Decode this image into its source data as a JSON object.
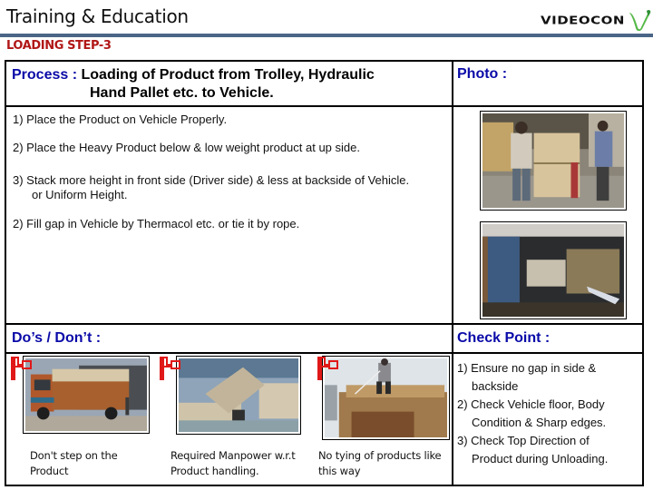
{
  "header": {
    "title": "Training & Education",
    "brand": "VIDEOCON",
    "brand_color": "#55b847",
    "rule_color": "#4a6585",
    "subtitle": "LOADING STEP-3",
    "subtitle_color": "#b11616"
  },
  "process": {
    "label": "Process :",
    "line1": "Loading of Product from Trolley,  Hydraulic",
    "line2": "Hand Pallet etc. to Vehicle."
  },
  "photo_section": {
    "label": "Photo :",
    "photos": [
      {
        "alt": "Workers moving boxed product on hydraulic hand pallet in warehouse"
      },
      {
        "alt": "Inside of container vehicle with loaded product"
      }
    ]
  },
  "steps": [
    {
      "line1": "1) Place the Product on Vehicle Properly.",
      "line2": ""
    },
    {
      "line1": "2) Place the Heavy Product below & low weight product at up side.",
      "line2": ""
    },
    {
      "line1": "3) Stack more height in front side (Driver side) & less at backside of Vehicle.",
      "line2": "or Uniform Height."
    },
    {
      "line1": "2) Fill gap in Vehicle by Thermacol etc. or tie it by rope.",
      "line2": ""
    }
  ],
  "dos_donts": {
    "label": "Do’s / Don’t :",
    "items": [
      {
        "caption1": "Don't step on the",
        "caption2": "Product",
        "alt": "Loaded truck with products"
      },
      {
        "caption1": "Required Manpower w.r.t",
        "caption2": "Product handling.",
        "alt": "Worker handling tilted product box"
      },
      {
        "caption1": "No tying of products like",
        "caption2": "this way",
        "alt": "Worker tying products with rope on top of vehicle"
      }
    ]
  },
  "check_point": {
    "label": "Check Point :",
    "items": [
      {
        "line1": "1) Ensure no gap in side &",
        "line2": "backside"
      },
      {
        "line1": "2) Check Vehicle floor,  Body",
        "line2": "Condition & Sharp edges."
      },
      {
        "line1": "3) Check Top Direction of",
        "line2": " Product during Unloading."
      }
    ]
  }
}
